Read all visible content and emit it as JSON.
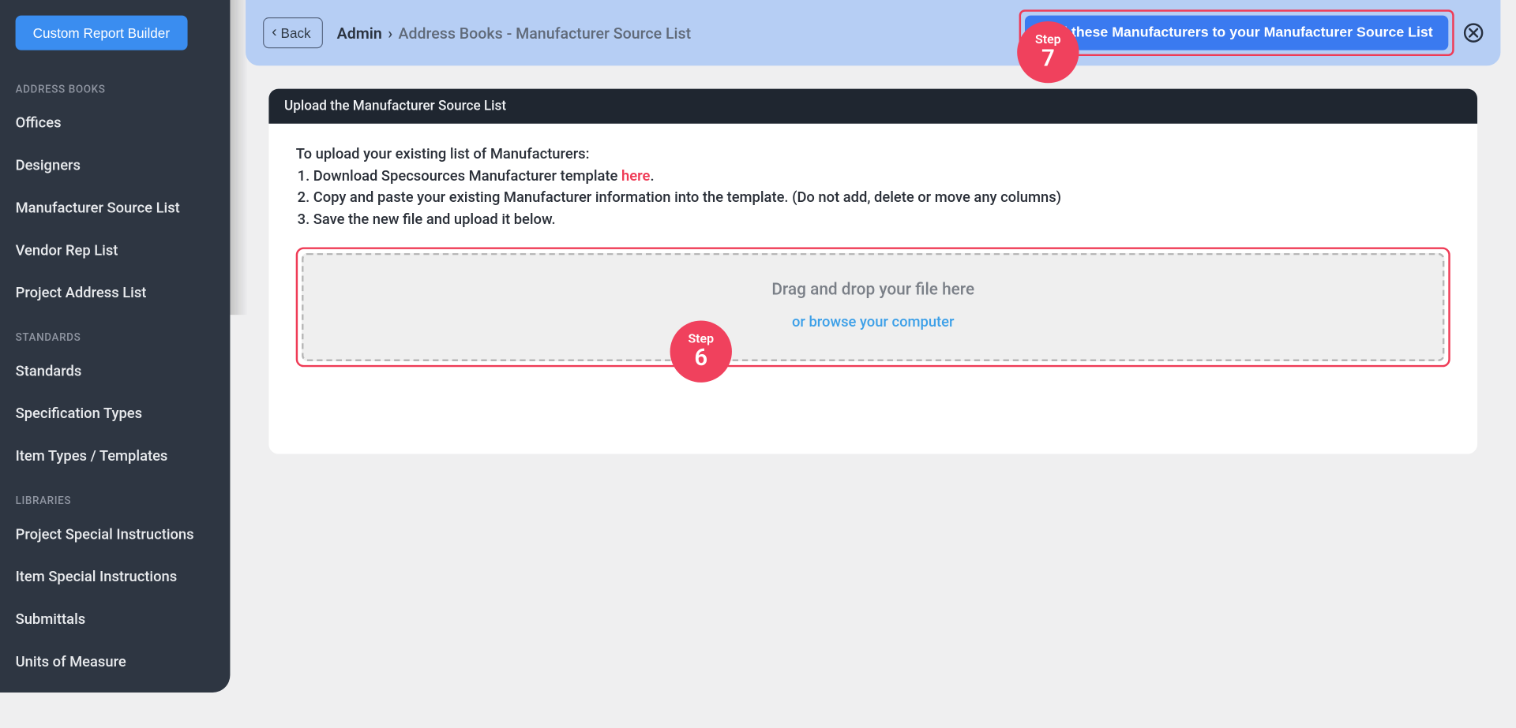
{
  "sidebar": {
    "custom_report_builder": "Custom Report Builder",
    "sections": [
      {
        "label": "ADDRESS BOOKS",
        "items": [
          "Offices",
          "Designers",
          "Manufacturer Source List",
          "Vendor Rep List",
          "Project Address List"
        ]
      },
      {
        "label": "STANDARDS",
        "items": [
          "Standards",
          "Specification Types",
          "Item Types / Templates"
        ]
      },
      {
        "label": "LIBRARIES",
        "items": [
          "Project Special Instructions",
          "Item Special Instructions",
          "Submittals",
          "Units of Measure"
        ]
      }
    ]
  },
  "topbar": {
    "back_label": "Back",
    "breadcrumb1": "Admin",
    "breadcrumb2": "Address Books - Manufacturer Source List",
    "add_button": "Add these Manufacturers to your Manufacturer Source List"
  },
  "panel": {
    "header": "Upload the Manufacturer Source List",
    "intro": "To upload your existing list of Manufacturers:",
    "step1_pre": "Download Specsources Manufacturer template ",
    "step1_link": "here",
    "step1_post": ".",
    "step2": "Copy and paste your existing Manufacturer information into the template. (Do not add, delete or move any columns)",
    "step3": "Save the new file and upload it below.",
    "drop_title": "Drag and drop your file here",
    "drop_link": "or browse your computer"
  },
  "badges": {
    "step_label": "Step",
    "step7": "7",
    "step6": "6"
  }
}
